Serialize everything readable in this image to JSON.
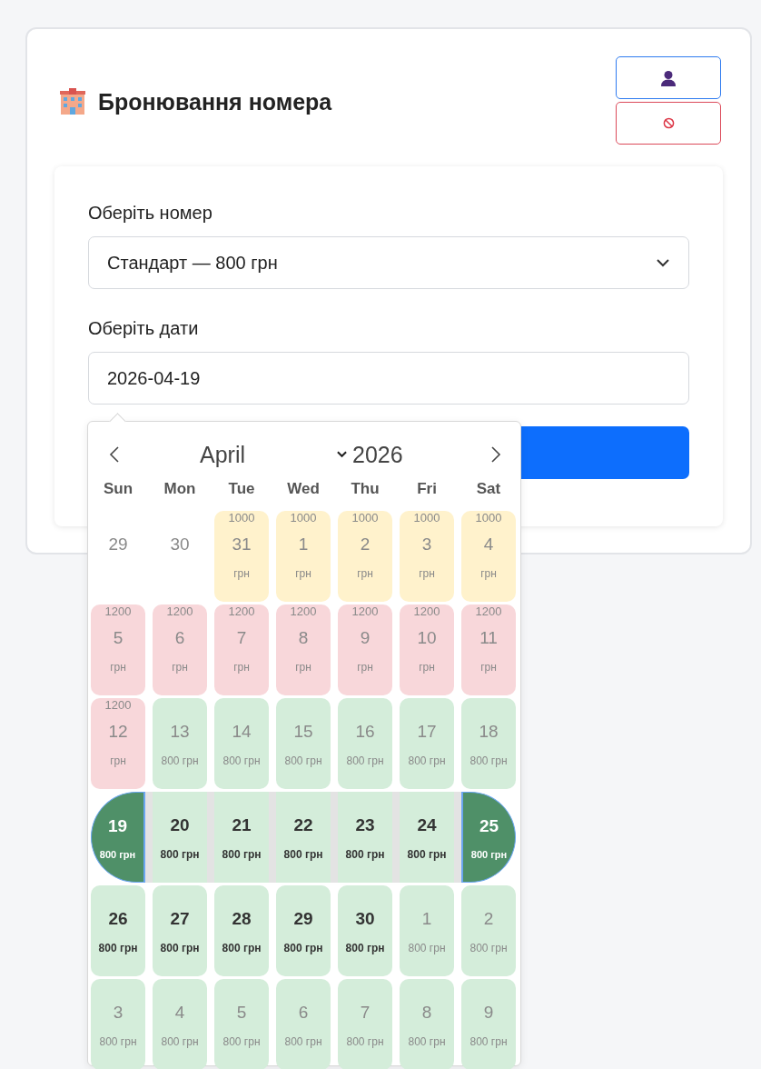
{
  "header": {
    "title": "Бронювання номера"
  },
  "form": {
    "room_label": "Оберіть номер",
    "room_value": "Стандарт — 800 грн",
    "dates_label": "Оберіть дати",
    "dates_value": "2026-04-19"
  },
  "calendar": {
    "month": "April",
    "year": "2026",
    "weekdays": [
      "Sun",
      "Mon",
      "Tue",
      "Wed",
      "Thu",
      "Fri",
      "Sat"
    ],
    "weeks": [
      [
        {
          "day": "29",
          "disabled": true,
          "selected": false,
          "in_range": false
        },
        {
          "day": "30",
          "disabled": true,
          "selected": false,
          "in_range": false
        },
        {
          "day": "31",
          "color": "#fff2cc",
          "disabled": true,
          "selected": false,
          "in_range": false,
          "prices": [
            "1000",
            "грн"
          ]
        },
        {
          "day": "1",
          "color": "#fff2cc",
          "disabled": true,
          "selected": false,
          "in_range": false,
          "prices": [
            "1000",
            "грн"
          ]
        },
        {
          "day": "2",
          "color": "#fff2cc",
          "disabled": true,
          "selected": false,
          "in_range": false,
          "prices": [
            "1000",
            "грн"
          ]
        },
        {
          "day": "3",
          "color": "#fff2cc",
          "disabled": true,
          "selected": false,
          "in_range": false,
          "prices": [
            "1000",
            "грн"
          ]
        },
        {
          "day": "4",
          "color": "#fff2cc",
          "disabled": true,
          "selected": false,
          "in_range": false,
          "prices": [
            "1000",
            "грн"
          ]
        }
      ],
      [
        {
          "day": "5",
          "color": "#f8d7da",
          "disabled": true,
          "selected": false,
          "in_range": false,
          "prices": [
            "1200",
            "грн"
          ]
        },
        {
          "day": "6",
          "color": "#f8d7da",
          "disabled": true,
          "selected": false,
          "in_range": false,
          "prices": [
            "1200",
            "грн"
          ]
        },
        {
          "day": "7",
          "color": "#f8d7da",
          "disabled": true,
          "selected": false,
          "in_range": false,
          "prices": [
            "1200",
            "грн"
          ]
        },
        {
          "day": "8",
          "color": "#f8d7da",
          "disabled": true,
          "selected": false,
          "in_range": false,
          "prices": [
            "1200",
            "грн"
          ]
        },
        {
          "day": "9",
          "color": "#f8d7da",
          "disabled": true,
          "selected": false,
          "in_range": false,
          "prices": [
            "1200",
            "грн"
          ]
        },
        {
          "day": "10",
          "color": "#f8d7da",
          "disabled": true,
          "selected": false,
          "in_range": false,
          "prices": [
            "1200",
            "грн"
          ]
        },
        {
          "day": "11",
          "color": "#f8d7da",
          "disabled": true,
          "selected": false,
          "in_range": false,
          "prices": [
            "1200",
            "грн"
          ]
        }
      ],
      [
        {
          "day": "12",
          "color": "#f8d7da",
          "disabled": true,
          "selected": false,
          "in_range": false,
          "prices": [
            "1200",
            "грн"
          ]
        },
        {
          "day": "13",
          "color": "#d4edda",
          "disabled": true,
          "selected": false,
          "in_range": false,
          "prices": [
            "800 грн"
          ]
        },
        {
          "day": "14",
          "color": "#d4edda",
          "disabled": true,
          "selected": false,
          "in_range": false,
          "prices": [
            "800 грн"
          ]
        },
        {
          "day": "15",
          "color": "#d4edda",
          "disabled": true,
          "selected": false,
          "in_range": false,
          "prices": [
            "800 грн"
          ]
        },
        {
          "day": "16",
          "color": "#d4edda",
          "disabled": true,
          "selected": false,
          "in_range": false,
          "prices": [
            "800 грн"
          ]
        },
        {
          "day": "17",
          "color": "#d4edda",
          "disabled": true,
          "selected": false,
          "in_range": false,
          "prices": [
            "800 грн"
          ]
        },
        {
          "day": "18",
          "color": "#d4edda",
          "disabled": true,
          "selected": false,
          "in_range": false,
          "prices": [
            "800 грн"
          ]
        }
      ],
      [
        {
          "day": "19",
          "disabled": false,
          "selected": true,
          "in_range": false,
          "prices": [
            "800 грн"
          ]
        },
        {
          "day": "20",
          "color": "#d4edda",
          "disabled": false,
          "selected": false,
          "in_range": true,
          "prices": [
            "800 грн"
          ]
        },
        {
          "day": "21",
          "color": "#d4edda",
          "disabled": false,
          "selected": false,
          "in_range": true,
          "prices": [
            "800 грн"
          ]
        },
        {
          "day": "22",
          "color": "#d4edda",
          "disabled": false,
          "selected": false,
          "in_range": true,
          "prices": [
            "800 грн"
          ]
        },
        {
          "day": "23",
          "color": "#d4edda",
          "disabled": false,
          "selected": false,
          "in_range": true,
          "prices": [
            "800 грн"
          ]
        },
        {
          "day": "24",
          "color": "#d4edda",
          "disabled": false,
          "selected": false,
          "in_range": true,
          "prices": [
            "800 грн"
          ]
        },
        {
          "day": "25",
          "disabled": false,
          "selected": true,
          "in_range": false,
          "prices": [
            "800 грн"
          ]
        }
      ],
      [
        {
          "day": "26",
          "color": "#d4edda",
          "disabled": false,
          "selected": false,
          "in_range": false,
          "prices": [
            "800 грн"
          ]
        },
        {
          "day": "27",
          "color": "#d4edda",
          "disabled": false,
          "selected": false,
          "in_range": false,
          "prices": [
            "800 грн"
          ]
        },
        {
          "day": "28",
          "color": "#d4edda",
          "disabled": false,
          "selected": false,
          "in_range": false,
          "prices": [
            "800 грн"
          ]
        },
        {
          "day": "29",
          "color": "#d4edda",
          "disabled": false,
          "selected": false,
          "in_range": false,
          "prices": [
            "800 грн"
          ]
        },
        {
          "day": "30",
          "color": "#d4edda",
          "disabled": false,
          "selected": false,
          "in_range": false,
          "prices": [
            "800 грн"
          ]
        },
        {
          "day": "1",
          "color": "#d4edda",
          "disabled": true,
          "selected": false,
          "in_range": false,
          "prices": [
            "800 грн"
          ]
        },
        {
          "day": "2",
          "color": "#d4edda",
          "disabled": true,
          "selected": false,
          "in_range": false,
          "prices": [
            "800 грн"
          ]
        }
      ],
      [
        {
          "day": "3",
          "color": "#d4edda",
          "disabled": true,
          "selected": false,
          "in_range": false,
          "prices": [
            "800 грн"
          ]
        },
        {
          "day": "4",
          "color": "#d4edda",
          "disabled": true,
          "selected": false,
          "in_range": false,
          "prices": [
            "800 грн"
          ]
        },
        {
          "day": "5",
          "color": "#d4edda",
          "disabled": true,
          "selected": false,
          "in_range": false,
          "prices": [
            "800 грн"
          ]
        },
        {
          "day": "6",
          "color": "#d4edda",
          "disabled": true,
          "selected": false,
          "in_range": false,
          "prices": [
            "800 грн"
          ]
        },
        {
          "day": "7",
          "color": "#d4edda",
          "disabled": true,
          "selected": false,
          "in_range": false,
          "prices": [
            "800 грн"
          ]
        },
        {
          "day": "8",
          "color": "#d4edda",
          "disabled": true,
          "selected": false,
          "in_range": false,
          "prices": [
            "800 грн"
          ]
        },
        {
          "day": "9",
          "color": "#d4edda",
          "disabled": true,
          "selected": false,
          "in_range": false,
          "prices": [
            "800 грн"
          ]
        }
      ]
    ]
  }
}
